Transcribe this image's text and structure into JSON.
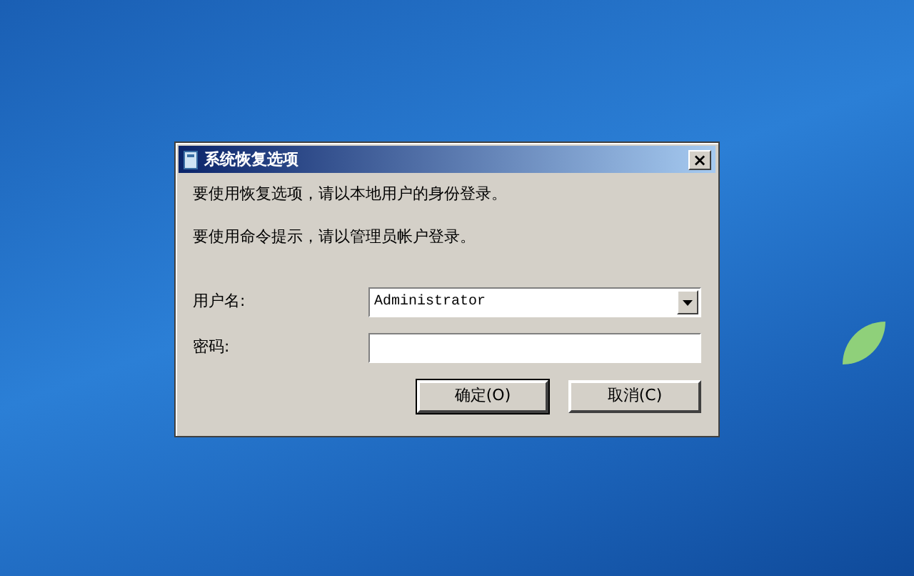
{
  "window": {
    "title": "系统恢复选项",
    "close": "×"
  },
  "messages": [
    "要使用恢复选项，请以本地用户的身份登录。",
    "要使用命令提示，请以管理员帐户登录。"
  ],
  "username": {
    "label": "用户名:",
    "value": "Administrator"
  },
  "password": {
    "label": "密码:"
  },
  "buttons": [
    {
      "label": "确定(O)",
      "default": true
    },
    {
      "label": "取消(C)",
      "default": false
    }
  ]
}
